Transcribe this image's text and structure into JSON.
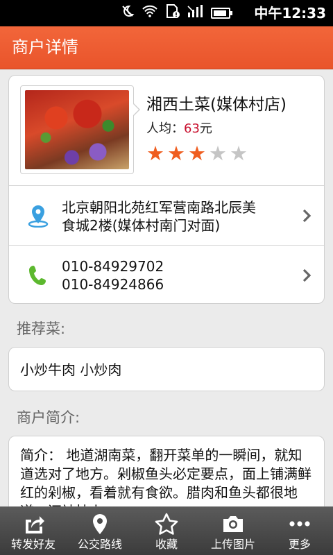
{
  "status_bar": {
    "time": "中午12:33",
    "icons": [
      "do-not-disturb-icon",
      "wifi-icon",
      "sim-alert-icon",
      "signal-icon",
      "battery-icon"
    ]
  },
  "header": {
    "title": "商户详情"
  },
  "merchant": {
    "name": "湘西土菜(媒体村店)",
    "avg_label": "人均：",
    "avg_price": "63",
    "avg_unit": "元",
    "rating": 3,
    "rating_max": 5,
    "address_line1": "北京朝阳北苑红军营南路北辰美",
    "address_line2": "食城2楼(媒体村南门对面)",
    "phone1": "010-84929702",
    "phone2": "010-84924866"
  },
  "recommended": {
    "label": "推荐菜:",
    "dishes": "小炒牛肉 小炒肉"
  },
  "intro": {
    "label": "商户简介:",
    "text": "简介： 地道湖南菜，翻开菜单的一瞬间，就知道选对了地方。剁椒鱼头必定要点，面上铺满鲜红的剁椒，看着就有食欲。腊肉和鱼头都很地道，还被挂上"
  },
  "toolbar": {
    "share": "转发好友",
    "route": "公交路线",
    "favorite": "收藏",
    "upload": "上传图片",
    "more": "更多"
  },
  "colors": {
    "accent": "#ef5d1f",
    "header": "#e9542b",
    "price": "#c8102e",
    "map_icon": "#3aa0e0",
    "phone_icon": "#5cb82e"
  }
}
